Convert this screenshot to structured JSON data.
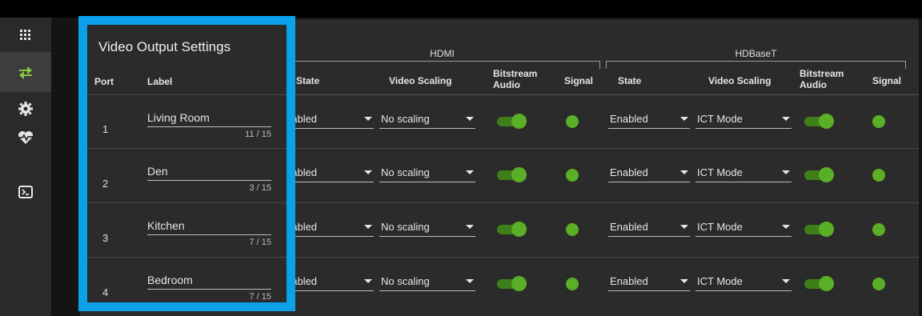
{
  "panel_title": "Video Output Settings",
  "groups": {
    "hdmi": "HDMI",
    "hdbaset": "HDBaseT"
  },
  "columns": {
    "port": "Port",
    "label": "Label",
    "hdmi_state": "State",
    "hdmi_scaling": "Video Scaling",
    "hdmi_bitstream": "Bitstream Audio",
    "hdmi_signal": "Signal",
    "hdb_state": "State",
    "hdb_scaling": "Video Scaling",
    "hdb_bitstream": "Bitstream Audio",
    "hdb_signal": "Signal"
  },
  "nav": [
    "grid-icon",
    "transfer-icon",
    "gear-icon",
    "heartbeat-icon",
    "terminal-icon"
  ],
  "active_nav": "transfer-icon",
  "colors": {
    "accent_green": "#5aaf27",
    "highlight_blue": "#0aa0ea",
    "nav_active": "#8cc63f"
  },
  "rows": [
    {
      "port": "1",
      "label": "Living Room",
      "counter": "11 / 15",
      "hdmi_state": "nabled",
      "hdmi_scaling": "No scaling",
      "hdmi_bitstream": true,
      "hdmi_signal": true,
      "hdb_state": "Enabled",
      "hdb_scaling": "ICT Mode",
      "hdb_bitstream": true,
      "hdb_signal": true
    },
    {
      "port": "2",
      "label": "Den",
      "counter": "3 / 15",
      "hdmi_state": "nabled",
      "hdmi_scaling": "No scaling",
      "hdmi_bitstream": true,
      "hdmi_signal": true,
      "hdb_state": "Enabled",
      "hdb_scaling": "ICT Mode",
      "hdb_bitstream": true,
      "hdb_signal": true
    },
    {
      "port": "3",
      "label": "Kitchen",
      "counter": "7 / 15",
      "hdmi_state": "nabled",
      "hdmi_scaling": "No scaling",
      "hdmi_bitstream": true,
      "hdmi_signal": true,
      "hdb_state": "Enabled",
      "hdb_scaling": "ICT Mode",
      "hdb_bitstream": true,
      "hdb_signal": true
    },
    {
      "port": "4",
      "label": "Bedroom",
      "counter": "7 / 15",
      "hdmi_state": "nabled",
      "hdmi_scaling": "No scaling",
      "hdmi_bitstream": true,
      "hdmi_signal": true,
      "hdb_state": "Enabled",
      "hdb_scaling": "ICT Mode",
      "hdb_bitstream": true,
      "hdb_signal": true
    }
  ]
}
